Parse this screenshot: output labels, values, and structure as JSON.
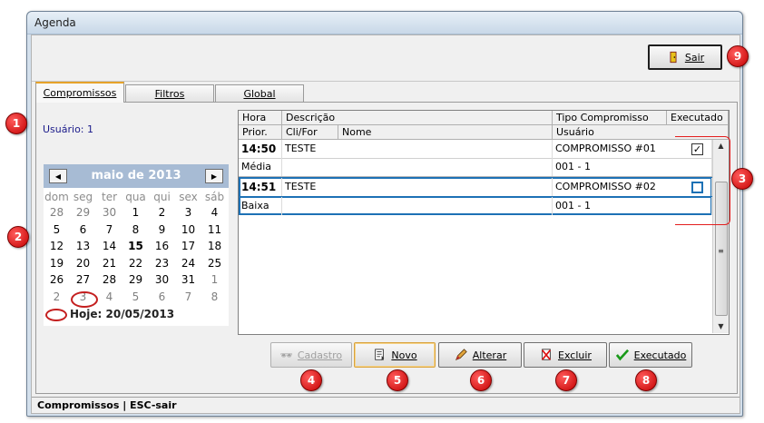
{
  "window": {
    "title": "Agenda"
  },
  "toolbar": {
    "sair": "Sair"
  },
  "tabs": [
    {
      "label": "Compromissos"
    },
    {
      "label": "Filtros"
    },
    {
      "label": "Global"
    }
  ],
  "panel": {
    "usuario": "Usuário: 1"
  },
  "calendar": {
    "month_label": "maio de 2013",
    "weekdays": [
      "dom",
      "seg",
      "ter",
      "qua",
      "qui",
      "sex",
      "sáb"
    ],
    "weeks": [
      [
        "28",
        "29",
        "30",
        "1",
        "2",
        "3",
        "4"
      ],
      [
        "5",
        "6",
        "7",
        "8",
        "9",
        "10",
        "11"
      ],
      [
        "12",
        "13",
        "14",
        "15",
        "16",
        "17",
        "18"
      ],
      [
        "19",
        "20",
        "21",
        "22",
        "23",
        "24",
        "25"
      ],
      [
        "26",
        "27",
        "28",
        "29",
        "30",
        "31",
        "1"
      ],
      [
        "2",
        "3",
        "4",
        "5",
        "6",
        "7",
        "8"
      ]
    ],
    "today_label": "Hoje: 20/05/2013"
  },
  "grid": {
    "headers_row1": [
      "Hora",
      "Descrição",
      "Tipo Compromisso",
      "Executado"
    ],
    "headers_row2": [
      "Prior.",
      "Cli/For",
      "Nome",
      "Usuário"
    ],
    "records": [
      {
        "hora": "14:50",
        "descricao": "TESTE",
        "tipo": "COMPROMISSO #01",
        "executado": true,
        "prioridade": "Média",
        "usuario": "001 - 1"
      },
      {
        "hora": "14:51",
        "descricao": "TESTE",
        "tipo": "COMPROMISSO #02",
        "executado": false,
        "prioridade": "Baixa",
        "usuario": "001 - 1"
      }
    ]
  },
  "actions": {
    "cadastro": "Cadastro",
    "novo": "Novo",
    "alterar": "Alterar",
    "excluir": "Excluir",
    "executado": "Executado"
  },
  "status_bar": "Compromissos  |  ESC-sair",
  "badges": [
    "1",
    "2",
    "3",
    "4",
    "5",
    "6",
    "7",
    "8",
    "9"
  ],
  "colors": {
    "accent_blue": "#1d71b5",
    "badge_red": "#d10000",
    "calendar_header": "#a7bbd4",
    "tab_active": "#e6a32a"
  }
}
